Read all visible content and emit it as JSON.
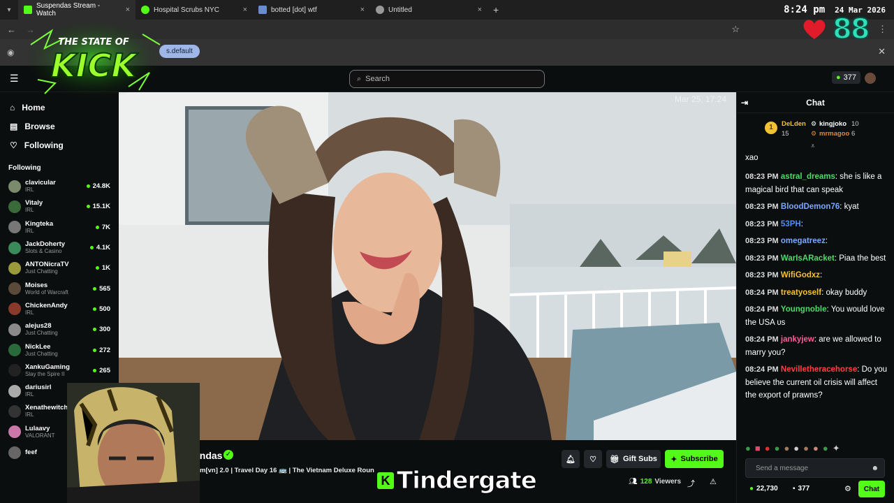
{
  "tabs": [
    {
      "label": "Suspendas Stream - Watch",
      "color": "#53fc18"
    },
    {
      "label": "Hospital Scrubs NYC",
      "color": "#53fc18"
    },
    {
      "label": "botted [dot] wtf",
      "color": "#6a8ccf"
    },
    {
      "label": "Untitled",
      "color": "#999"
    }
  ],
  "clock": {
    "time": "8:24 pm",
    "date": "24 Mar 2026"
  },
  "overlay_counter": "88",
  "bookmark_pill": "s.default",
  "logo": {
    "line1": "THE STATE OF",
    "line2": "KICK"
  },
  "search": {
    "placeholder": "Search"
  },
  "header_coins": "377",
  "nav": [
    {
      "label": "Home",
      "icon": "home-icon"
    },
    {
      "label": "Browse",
      "icon": "browse-icon"
    },
    {
      "label": "Following",
      "icon": "heart-icon"
    }
  ],
  "following_title": "Following",
  "following": [
    {
      "name": "clavicular",
      "cat": "IRL",
      "count": "24.8K",
      "color": "#7a8a6a"
    },
    {
      "name": "Vitaly",
      "cat": "IRL",
      "count": "15.1K",
      "color": "#3a6a3a"
    },
    {
      "name": "Kingteka",
      "cat": "IRL",
      "count": "7K",
      "color": "#777"
    },
    {
      "name": "JackDoherty",
      "cat": "Slots & Casino",
      "count": "4.1K",
      "color": "#3a8a5a"
    },
    {
      "name": "ANTONicraTV",
      "cat": "Just Chatting",
      "count": "1K",
      "color": "#9a9a3a"
    },
    {
      "name": "Moises",
      "cat": "World of Warcraft",
      "count": "565",
      "color": "#5a4a3a"
    },
    {
      "name": "ChickenAndy",
      "cat": "IRL",
      "count": "500",
      "color": "#8a3a2a"
    },
    {
      "name": "alejus28",
      "cat": "Just Chatting",
      "count": "300",
      "color": "#8a8a8a"
    },
    {
      "name": "NickLee",
      "cat": "Just Chatting",
      "count": "272",
      "color": "#2a6a3a"
    },
    {
      "name": "XankuGaming",
      "cat": "Slay the Spire II",
      "count": "265",
      "color": "#222"
    },
    {
      "name": "dariusirl",
      "cat": "IRL",
      "count": "",
      "color": "#aaa"
    },
    {
      "name": "Xenathewitch",
      "cat": "IRL",
      "count": "",
      "color": "#333"
    },
    {
      "name": "Lulaavy",
      "cat": "VALORANT",
      "count": "",
      "color": "#c7a"
    },
    {
      "name": "feef",
      "cat": "",
      "count": "",
      "color": "#666"
    }
  ],
  "video": {
    "watermark": "Mar 25, 17:24"
  },
  "stream": {
    "name_fragment": "endas",
    "title_fragment": "m[vn] 2.0 | Travel Day 16 🚌 | The Vietnam Deluxe Roun",
    "viewers": "128",
    "viewers_label": "Viewers",
    "overlay_text": "Tindergate"
  },
  "actions": {
    "gift": "Gift Subs",
    "subscribe": "Subscribe"
  },
  "chat": {
    "title": "Chat",
    "leaders": [
      {
        "name": "DeLden",
        "count": "15"
      },
      {
        "name": "kingjoko",
        "count": "10"
      },
      {
        "name": "mrmagoo",
        "count": "6"
      }
    ],
    "partial": "xao",
    "messages": [
      {
        "time": "08:23 PM",
        "user": "astral_dreams",
        "color": "#4fd96a",
        "text": "she is like a magical bird that can speak"
      },
      {
        "time": "08:23 PM",
        "user": "BloodDemon76",
        "color": "#7aa8ff",
        "text": "kyat"
      },
      {
        "time": "08:23 PM",
        "user": "53PH",
        "color": "#4f8cff",
        "text": ""
      },
      {
        "time": "08:23 PM",
        "user": "omegatreez",
        "color": "#7aa8ff",
        "text": ""
      },
      {
        "time": "08:23 PM",
        "user": "WarIsARacket",
        "color": "#4fd96a",
        "text": "Piaa the best"
      },
      {
        "time": "08:23 PM",
        "user": "WifiGodxz",
        "color": "#f2c233",
        "text": ""
      },
      {
        "time": "08:24 PM",
        "user": "treatyoself",
        "color": "#f2c233",
        "text": "okay buddy"
      },
      {
        "time": "08:24 PM",
        "user": "Youngnoble",
        "color": "#4fd96a",
        "text": "You would love the USA ᴜѕ"
      },
      {
        "time": "08:24 PM",
        "user": "jankyjew",
        "color": "#ff5a9a",
        "text": "are we allowed to marry you?"
      },
      {
        "time": "08:24 PM",
        "user": "Nevilletheracehorse",
        "color": "#ff4040",
        "text": "Do you believe the current oil crisis will affect the export of prawns?"
      }
    ],
    "placeholder": "Send a message",
    "footer_coins": "22,730",
    "footer_points": "377",
    "send_label": "Chat"
  }
}
